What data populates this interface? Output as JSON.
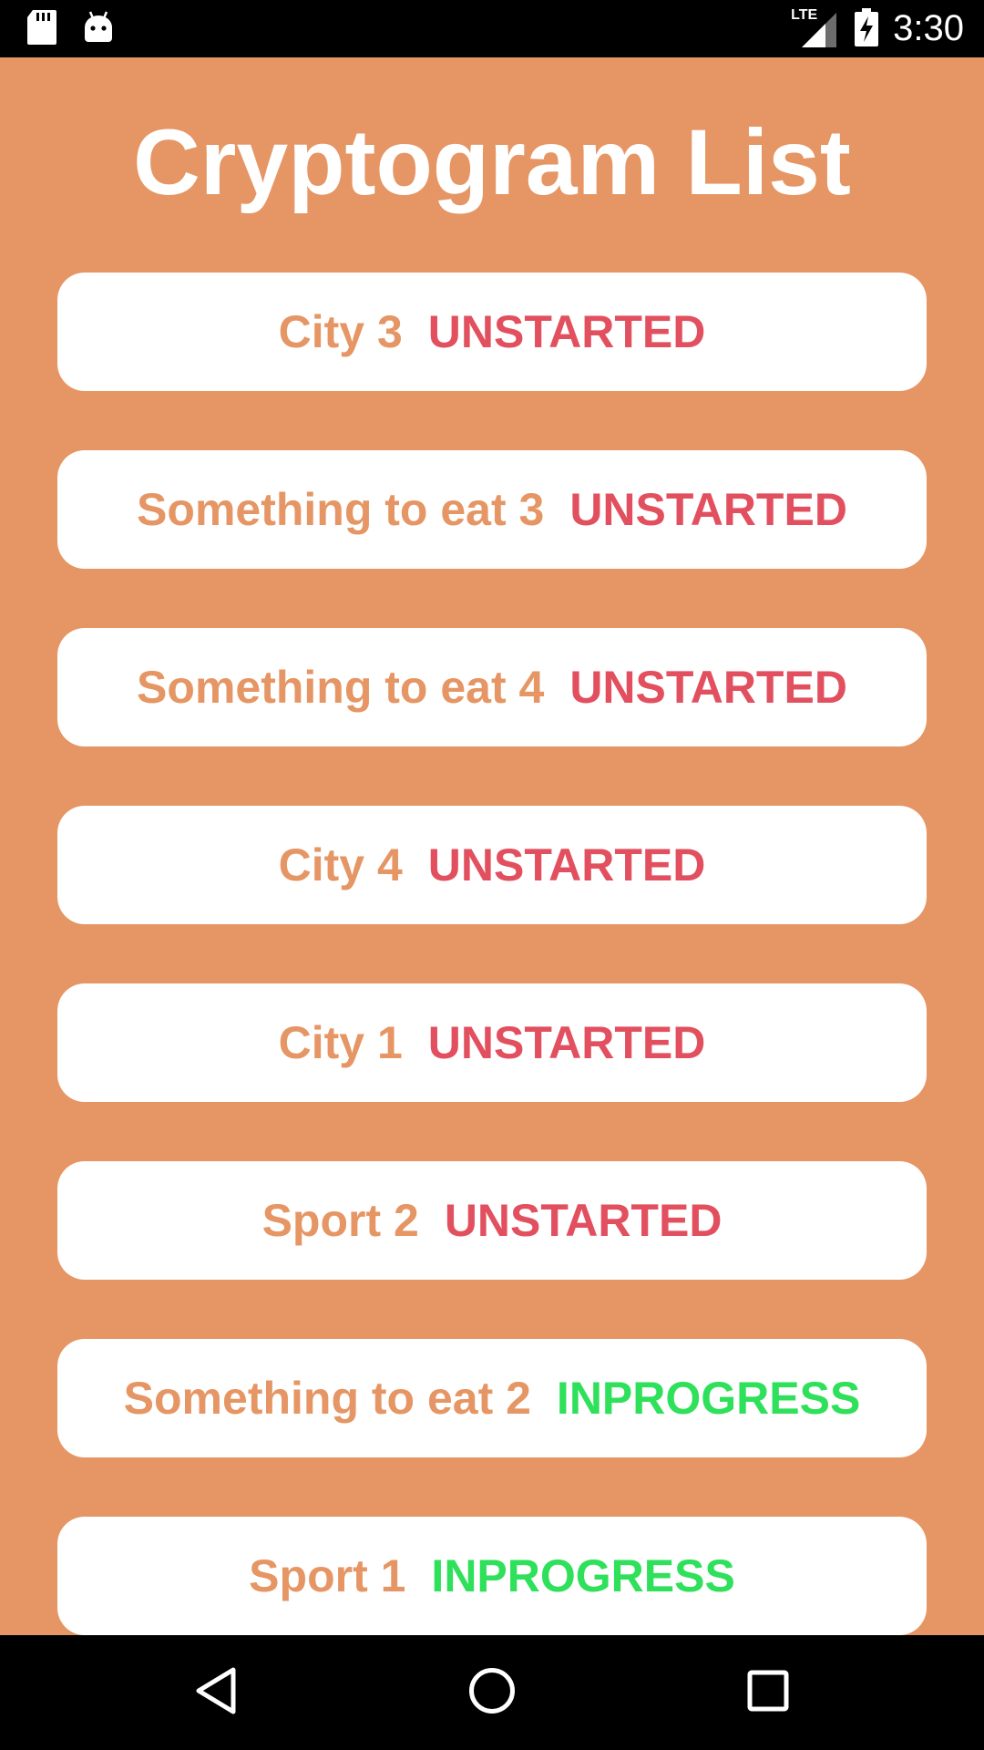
{
  "status_bar": {
    "time": "3:30",
    "network": "LTE",
    "icons": [
      "sd-card-icon",
      "android-icon",
      "signal-icon",
      "battery-charging-icon"
    ]
  },
  "page": {
    "title": "Cryptogram List"
  },
  "cryptograms": [
    {
      "name": "City 3",
      "status": "UNSTARTED"
    },
    {
      "name": "Something to eat 3",
      "status": "UNSTARTED"
    },
    {
      "name": "Something to eat 4",
      "status": "UNSTARTED"
    },
    {
      "name": "City 4",
      "status": "UNSTARTED"
    },
    {
      "name": "City 1",
      "status": "UNSTARTED"
    },
    {
      "name": "Sport 2",
      "status": "UNSTARTED"
    },
    {
      "name": "Something to eat 2",
      "status": "INPROGRESS"
    },
    {
      "name": "Sport 1",
      "status": "INPROGRESS"
    }
  ],
  "nav_bar": {
    "icons": [
      "back-icon",
      "home-icon",
      "recents-icon"
    ]
  },
  "colors": {
    "background": "#E59664",
    "card": "#FFFFFF",
    "name_text": "#E59664",
    "unstarted": "#E2505F",
    "inprogress": "#2EE05A"
  }
}
